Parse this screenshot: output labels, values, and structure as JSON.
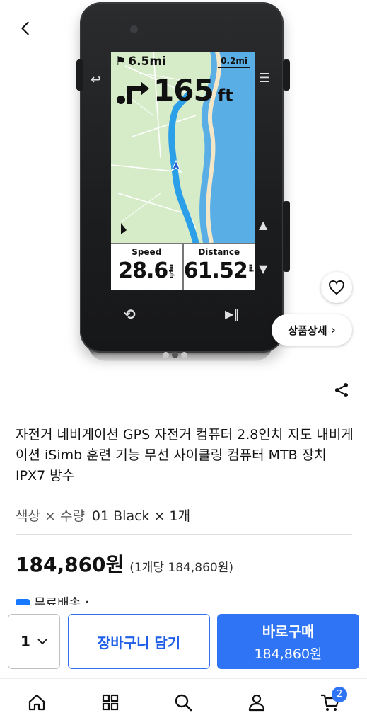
{
  "device_screen": {
    "distance_remaining": "6.5mi",
    "map_scale": "0.2mi",
    "turn_distance": "165",
    "turn_unit": "ft",
    "fields": [
      {
        "label": "Speed",
        "value": "28.6",
        "unit": "mph"
      },
      {
        "label": "Distance",
        "value": "61.52",
        "unit": "mi"
      }
    ]
  },
  "gallery": {
    "dots_total": 3,
    "active_dot": 1
  },
  "detail_button_label": "상품상세",
  "product": {
    "title": "자전거 네비게이션 GPS 자전거 컴퓨터 2.8인치 지도 내비게이션 iSimb 훈련 기능 무선 사이클링 컴퓨터 MTB 장치 IPX7 방수",
    "option_label": "색상 × 수량",
    "option_value": "01 Black × 1개",
    "price": "184,860원",
    "unit_price": "(1개당 184,860원)",
    "shipping_text": "무료배송 :"
  },
  "purchase": {
    "quantity": "1",
    "cart_label": "장바구니 담기",
    "buy_label": "바로구매",
    "buy_price": "184,860원"
  },
  "nav": {
    "items": [
      "home-icon",
      "categories-icon",
      "search-icon",
      "profile-icon",
      "cart-icon"
    ],
    "cart_count": "2"
  },
  "colors": {
    "accent": "#2f74f5",
    "accent_border": "#2f6ff0",
    "text": "#111111"
  }
}
